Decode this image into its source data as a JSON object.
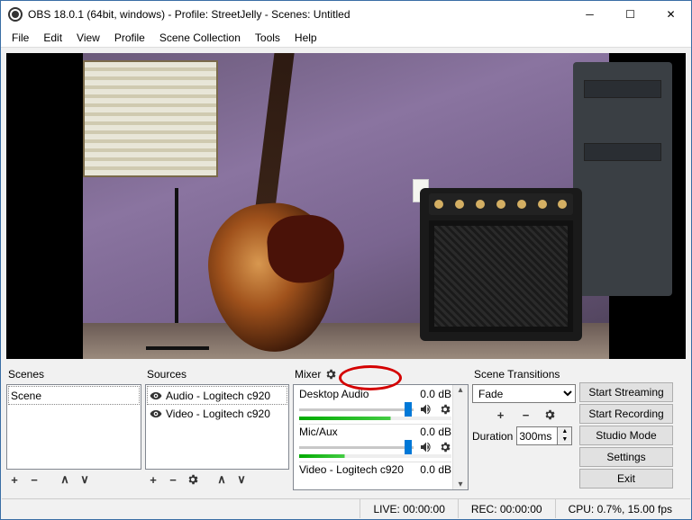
{
  "window": {
    "title": "OBS 18.0.1 (64bit, windows) - Profile: StreetJelly - Scenes: Untitled"
  },
  "menu": [
    "File",
    "Edit",
    "View",
    "Profile",
    "Scene Collection",
    "Tools",
    "Help"
  ],
  "panels": {
    "scenes": {
      "title": "Scenes",
      "items": [
        "Scene"
      ]
    },
    "sources": {
      "title": "Sources",
      "items": [
        {
          "label": "Audio - Logitech c920",
          "visible": true
        },
        {
          "label": "Video - Logitech c920",
          "visible": true
        }
      ]
    },
    "mixer": {
      "title": "Mixer",
      "channels": [
        {
          "name": "Desktop Audio",
          "db": "0.0 dB"
        },
        {
          "name": "Mic/Aux",
          "db": "0.0 dB"
        },
        {
          "name": "Video - Logitech c920",
          "db": "0.0 dB"
        }
      ]
    },
    "transitions": {
      "title": "Scene Transitions",
      "selected": "Fade",
      "duration_label": "Duration",
      "duration_value": "300ms"
    }
  },
  "buttons": {
    "start_streaming": "Start Streaming",
    "start_recording": "Start Recording",
    "studio_mode": "Studio Mode",
    "settings": "Settings",
    "exit": "Exit"
  },
  "status": {
    "live": "LIVE: 00:00:00",
    "rec": "REC: 00:00:00",
    "cpu": "CPU: 0.7%, 15.00 fps"
  },
  "icons": {
    "plus": "+",
    "minus": "−",
    "up": "∧",
    "down": "∨"
  }
}
